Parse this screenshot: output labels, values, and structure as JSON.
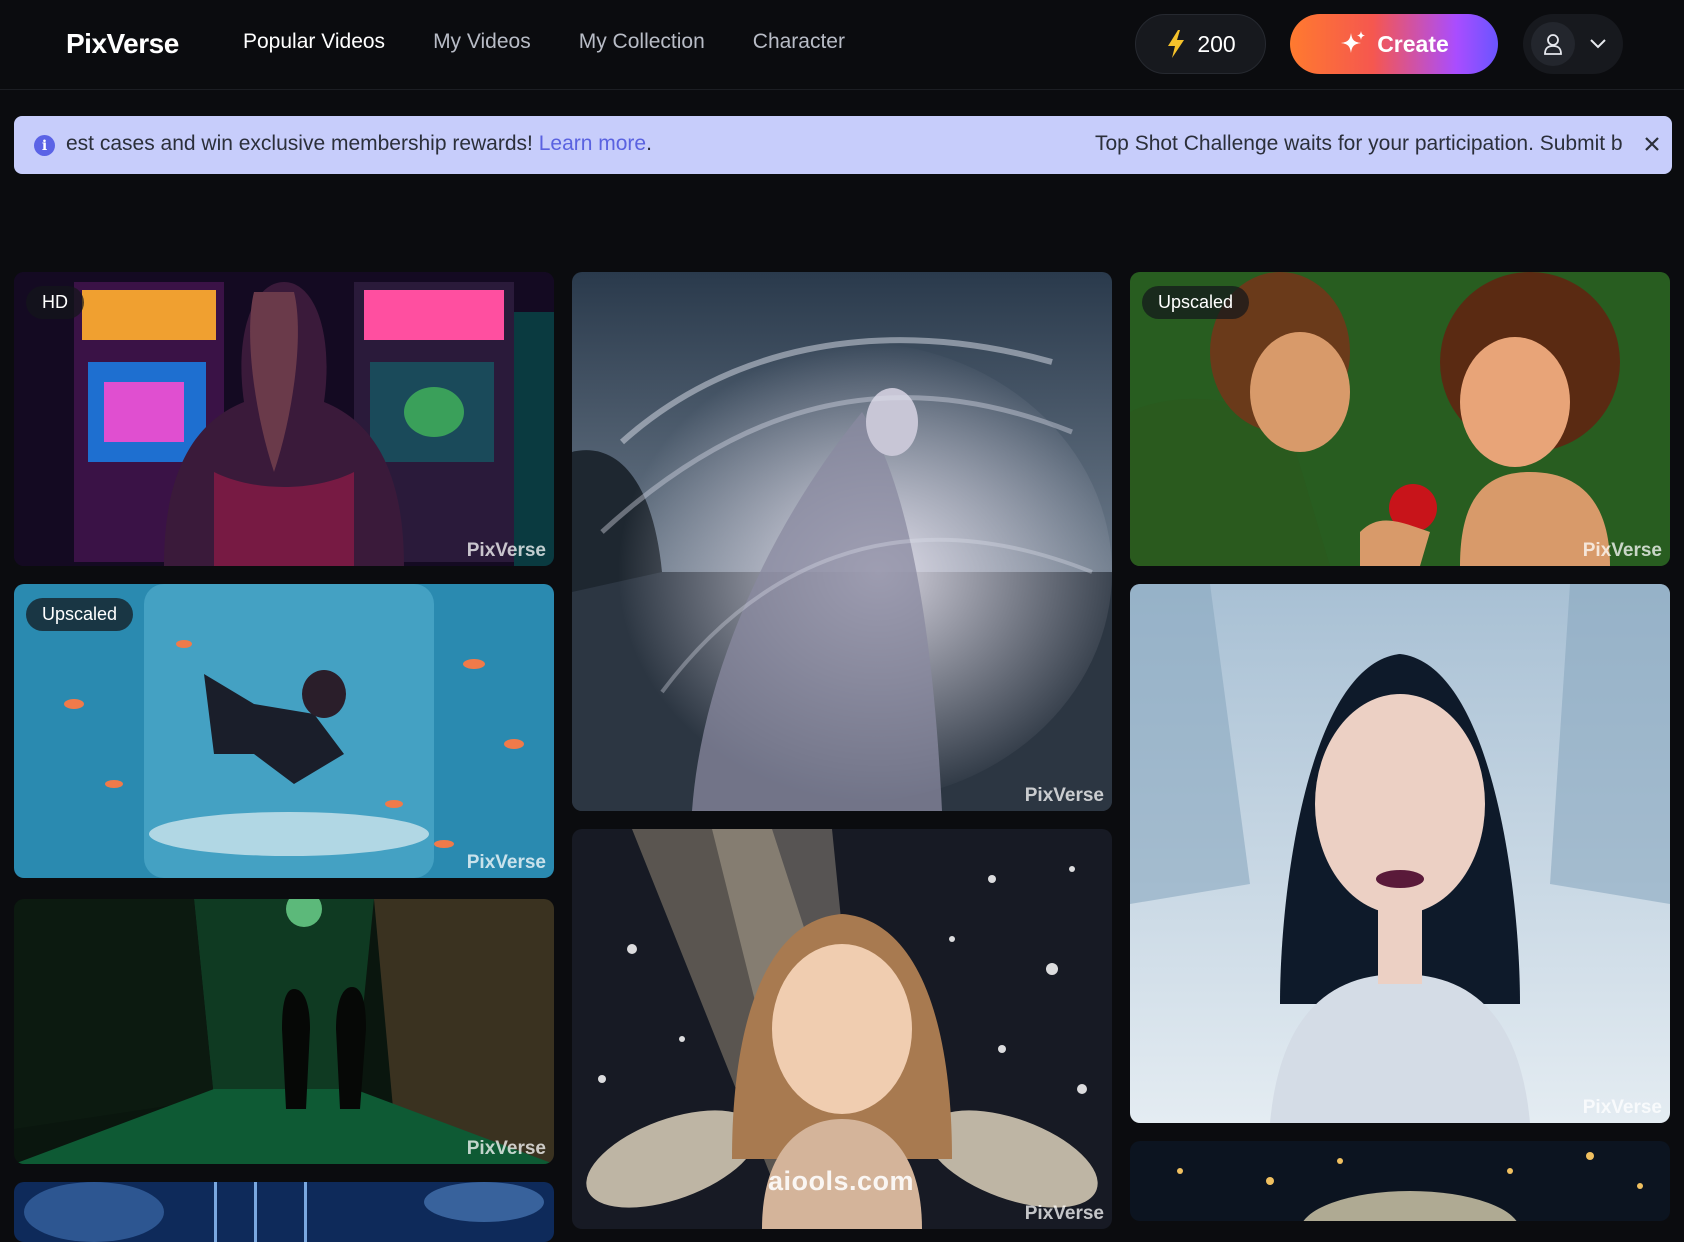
{
  "header": {
    "logo": "PixVerse",
    "nav": [
      "Popular Videos",
      "My Videos",
      "My Collection",
      "Character"
    ],
    "credits": "200",
    "create_label": "Create"
  },
  "banner": {
    "message_start": "est cases and win exclusive membership rewards!",
    "learn_more": "Learn more",
    "period": ".",
    "message_end": "Top Shot Challenge waits for your participation. Submit b"
  },
  "gallery": {
    "watermark": "PixVerse",
    "cards": [
      {
        "badge": "HD",
        "subject": "arcade"
      },
      {
        "badge": "",
        "subject": "ethereal-woman-sea"
      },
      {
        "badge": "Upscaled",
        "subject": "forest-couple-apple"
      },
      {
        "badge": "Upscaled",
        "subject": "girl-in-aquarium"
      },
      {
        "badge": "",
        "subject": "snow-princess"
      },
      {
        "badge": "",
        "subject": "alley-night"
      },
      {
        "badge": "",
        "subject": "fairy-girl"
      }
    ]
  },
  "site_watermark": "aiools.com",
  "colors": {
    "background": "#0b0c0f",
    "banner_bg": "#c7cdfb",
    "link": "#5a62e0",
    "create_gradient": [
      "#ff7a2f",
      "#a94dff",
      "#6a55ff"
    ]
  }
}
